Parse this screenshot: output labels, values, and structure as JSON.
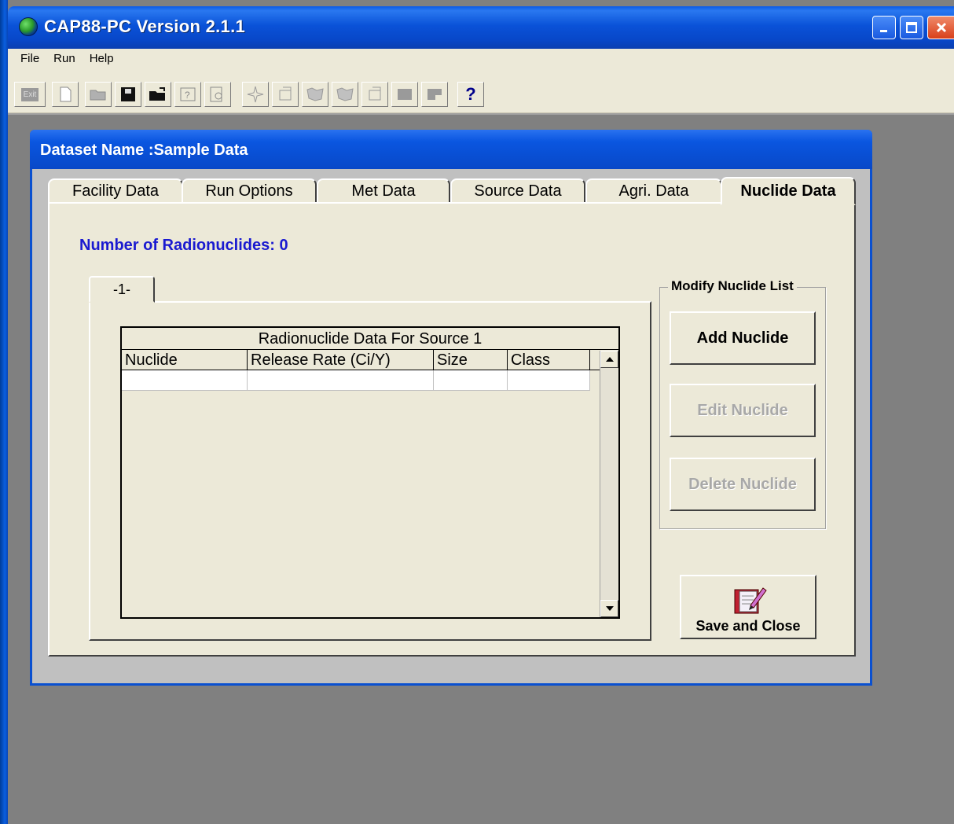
{
  "app": {
    "title": "CAP88-PC Version 2.1.1"
  },
  "menu": {
    "items": [
      "File",
      "Run",
      "Help"
    ]
  },
  "toolbar": {
    "exit_label": "Exit",
    "help_label": "?"
  },
  "dialog": {
    "title": "Dataset Name :Sample Data",
    "tabs": [
      "Facility Data",
      "Run Options",
      "Met Data",
      "Source Data",
      "Agri. Data",
      "Nuclide Data"
    ],
    "active_tab": "Nuclide Data",
    "count_label": "Number of Radionuclides: 0",
    "source_tab": "-1-",
    "table": {
      "caption": "Radionuclide Data For Source 1",
      "columns": [
        "Nuclide",
        "Release Rate (Ci/Y)",
        "Size",
        "Class"
      ]
    },
    "group_title": "Modify Nuclide List",
    "buttons": {
      "add": "Add Nuclide",
      "edit": "Edit Nuclide",
      "delete": "Delete Nuclide",
      "save_close": "Save and Close"
    }
  },
  "colors": {
    "titlebar": "#0a52d8",
    "panel": "#ece9d8",
    "desktop": "#808080",
    "count_text": "#1a1ad0"
  }
}
